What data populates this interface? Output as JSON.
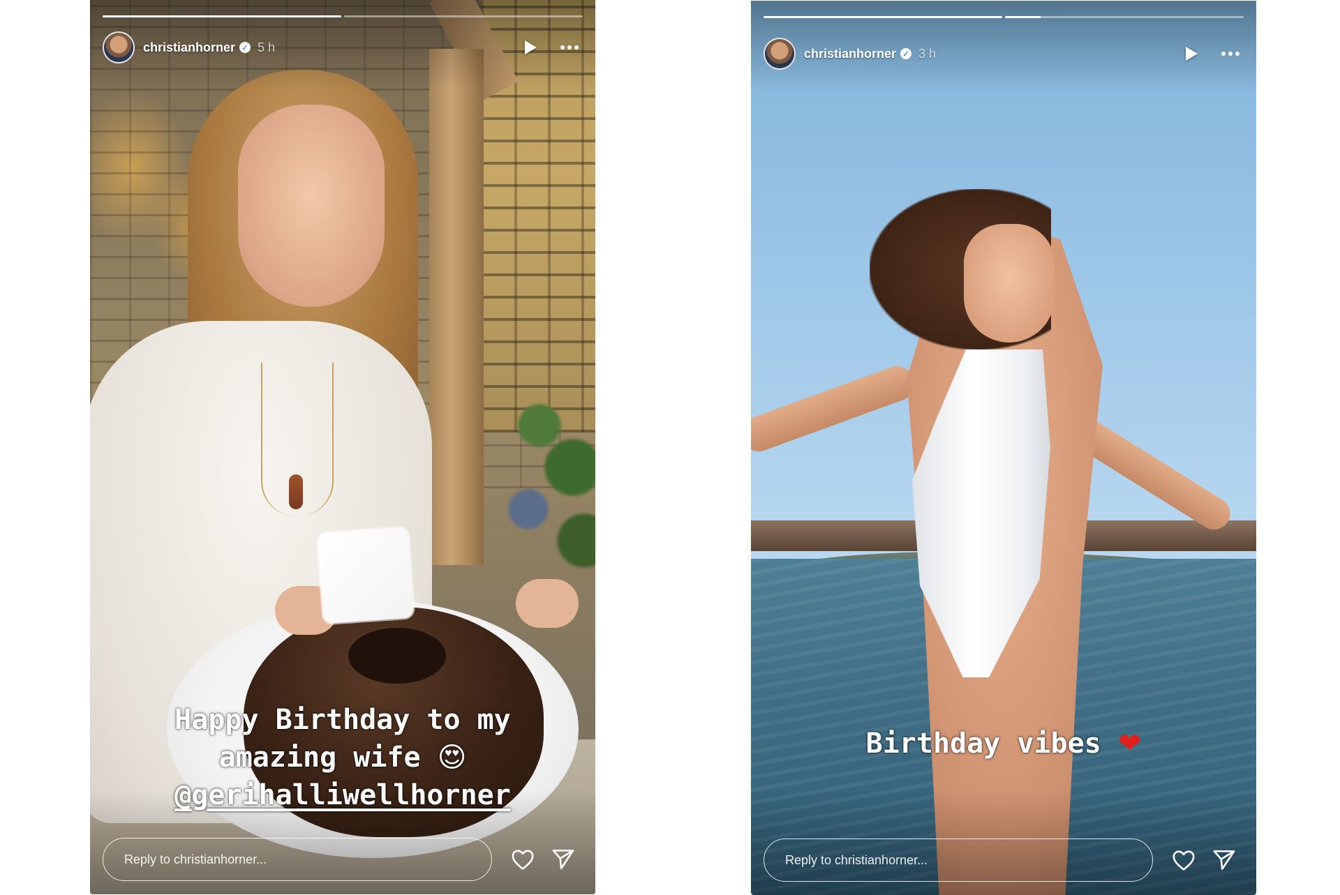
{
  "stories": [
    {
      "username": "christianhorner",
      "time": "5 h",
      "progress": [
        1.0,
        0.0
      ],
      "caption_lines": [
        "Happy Birthday to my",
        "amazing wife"
      ],
      "caption_emoji": "😍",
      "mention": "@gerihalliwellhorner",
      "reply_placeholder": "Reply to christianhorner..."
    },
    {
      "username": "christianhorner",
      "time": "3 h",
      "progress": [
        1.0,
        0.15
      ],
      "caption": "Birthday vibes",
      "caption_emoji": "❤",
      "reply_placeholder": "Reply to christianhorner..."
    }
  ],
  "icons": {
    "verified": "verified-badge-icon",
    "play": "play-icon",
    "more": "more-options-icon",
    "like": "heart-icon",
    "send": "send-icon"
  },
  "colors": {
    "verified_blue": "#3897f0",
    "heart_red": "#e0201d",
    "chrome": "#ffffff"
  }
}
